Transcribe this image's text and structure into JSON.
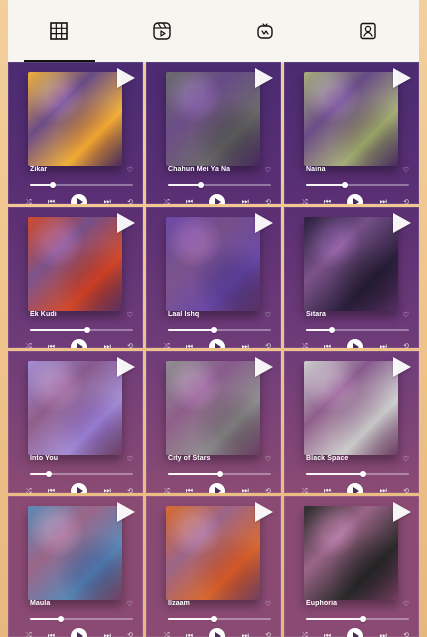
{
  "tabs": [
    {
      "name": "tab-grid",
      "icon": "grid-icon"
    },
    {
      "name": "tab-reels",
      "icon": "reels-icon"
    },
    {
      "name": "tab-igtv",
      "icon": "igtv-icon"
    },
    {
      "name": "tab-tagged",
      "icon": "tagged-icon"
    }
  ],
  "active_tab": 0,
  "colors": {
    "topbar_bg": "#f8f4ef",
    "row_colors": [
      "#4b2b72",
      "#5b2f73",
      "#6f3c79",
      "#8a4a74"
    ]
  },
  "cards": [
    {
      "title": "Zikar",
      "artist": "",
      "progress": 0.22,
      "art": "#f2b23a"
    },
    {
      "title": "Chahun Mei Ya Na",
      "artist": "",
      "progress": 0.32,
      "art": "#6b6b6b"
    },
    {
      "title": "Naina",
      "artist": "",
      "progress": 0.38,
      "art": "#a7b07a"
    },
    {
      "title": "Ek Kudi",
      "artist": "",
      "progress": 0.55,
      "art": "#d24b2b"
    },
    {
      "title": "Laal Ishq",
      "artist": "",
      "progress": 0.45,
      "art": "#6c4aa6"
    },
    {
      "title": "Sitara",
      "artist": "",
      "progress": 0.25,
      "art": "#2a1f3b"
    },
    {
      "title": "Into You",
      "artist": "",
      "progress": 0.18,
      "art": "#a58fd6"
    },
    {
      "title": "City of Stars",
      "artist": "",
      "progress": 0.5,
      "art": "#8f8f8f"
    },
    {
      "title": "Black Space",
      "artist": "",
      "progress": 0.55,
      "art": "#cfcfcf"
    },
    {
      "title": "Maula",
      "artist": "",
      "progress": 0.3,
      "art": "#5b89b6"
    },
    {
      "title": "Ilzaam",
      "artist": "",
      "progress": 0.45,
      "art": "#d86a2f"
    },
    {
      "title": "Euphoria",
      "artist": "",
      "progress": 0.55,
      "art": "#2a2a2a"
    }
  ]
}
